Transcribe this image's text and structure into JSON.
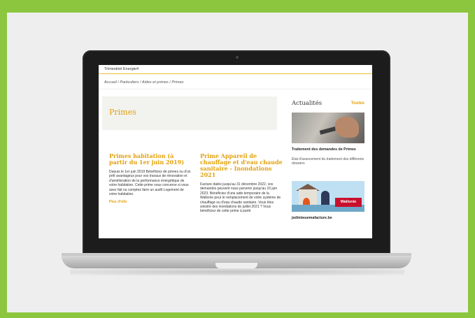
{
  "site": {
    "brand": "Trimestriel Energie4",
    "breadcrumb": "Accueil / Particuliers / Aides et primes / Primes"
  },
  "hero": {
    "title": "Primes"
  },
  "articles": [
    {
      "title": "Primes habitation (à partir du 1er juin 2019)",
      "text": "Depuis le 1er juin 2019 Bénéficiez de primes ou d'un prêt avantageux pour vos travaux de rénovation et d'amélioration de la performance énergétique de votre habitation. Cette prime vous concerne si vous avez fait ou comptez faire un audit Logement de votre habitation.",
      "more": "Plus d'info"
    },
    {
      "title": "Prime Appareil de chauffage et d'eau chaude sanitaire - Inondations 2021",
      "text": "Facture datée jusqu'au 31 décembre 2022, vos demandes peuvent nous parvenir jusqu'au 15 juin 2023. Bénéficiez d'une aide temporaire de la Wallonie pour le remplacement de votre système de chauffage ou d'eau chaude sanitaire. Vous êtes sinistré des inondations de juillet 2021 ? Vous bénéficiez de cette prime à partir"
    }
  ],
  "sidebar": {
    "title": "Actualités",
    "all_link": "Toutes",
    "news": [
      {
        "title": "Traitement des demandes de Primes",
        "text": "État d'avancement du traitement des différents dossiers",
        "image_badge": ""
      },
      {
        "title": "jedimінuemafacture.be",
        "image_badge": "Wallonie"
      }
    ]
  },
  "colors": {
    "accent": "#e2a20f",
    "background": "#8cc63f"
  }
}
